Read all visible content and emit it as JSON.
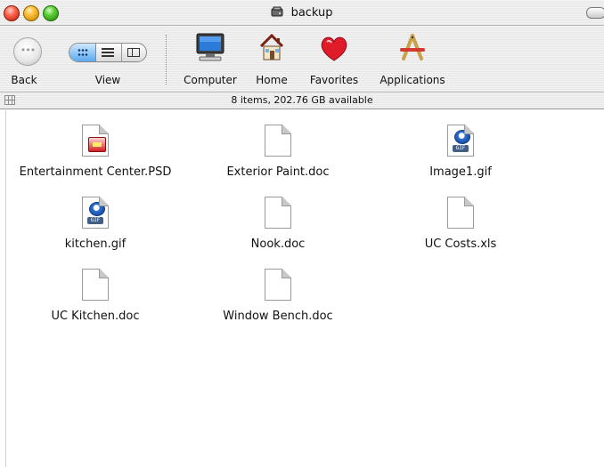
{
  "window": {
    "title": "backup",
    "title_icon": "hard-drive-icon"
  },
  "toolbar": {
    "back_label": "Back",
    "back_glyph": "•••",
    "view_label": "View",
    "items": [
      {
        "label": "Computer",
        "icon": "computer-icon"
      },
      {
        "label": "Home",
        "icon": "home-icon"
      },
      {
        "label": "Favorites",
        "icon": "favorites-heart-icon"
      },
      {
        "label": "Applications",
        "icon": "applications-icon"
      }
    ]
  },
  "status": {
    "text": "8 items, 202.76 GB available"
  },
  "files": [
    {
      "name": "Entertainment Center.PSD",
      "kind": "psd"
    },
    {
      "name": "Exterior Paint.doc",
      "kind": "doc"
    },
    {
      "name": "Image1.gif",
      "kind": "gif"
    },
    {
      "name": "kitchen.gif",
      "kind": "gif"
    },
    {
      "name": "Nook.doc",
      "kind": "doc"
    },
    {
      "name": "UC Costs.xls",
      "kind": "doc"
    },
    {
      "name": "UC Kitchen.doc",
      "kind": "doc"
    },
    {
      "name": "Window Bench.doc",
      "kind": "doc"
    }
  ],
  "colors": {
    "close": "#ff5f46",
    "minimize": "#ffbf3a",
    "zoom": "#5fd13a",
    "selected_view": "#5aa9ee"
  }
}
